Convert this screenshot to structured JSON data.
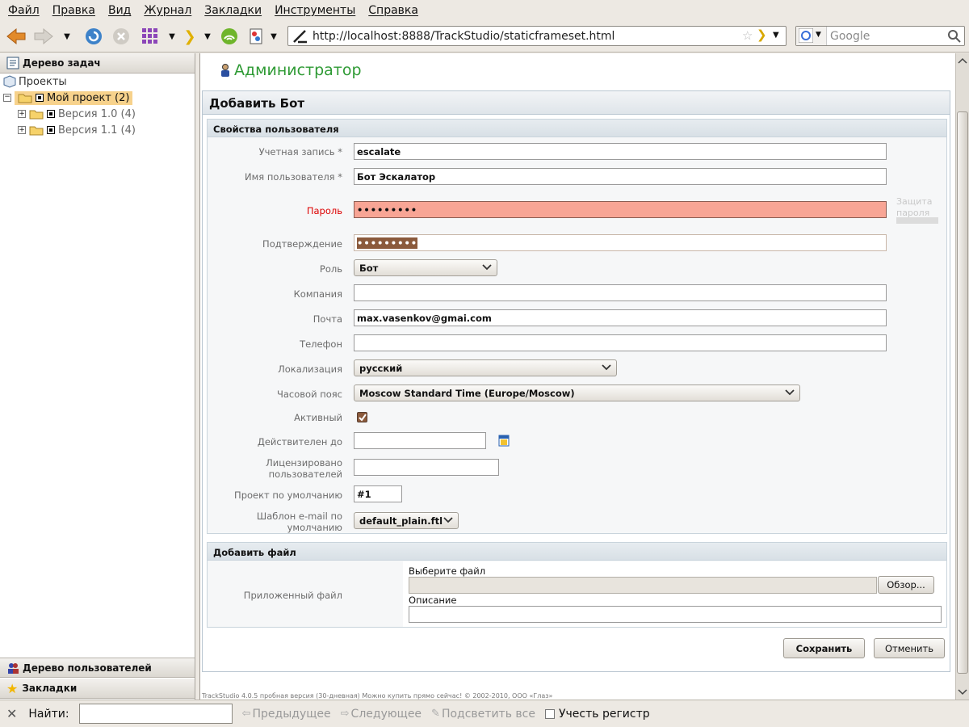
{
  "menu": [
    "Файл",
    "Правка",
    "Вид",
    "Журнал",
    "Закладки",
    "Инструменты",
    "Справка"
  ],
  "url": "http://localhost:8888/TrackStudio/staticframeset.html",
  "search_placeholder": "Google",
  "left": {
    "task_tree": "Дерево задач",
    "projects": "Проекты",
    "my_project": "Мой проект (2)",
    "v10": "Версия 1.0 (4)",
    "v11": "Версия 1.1 (4)",
    "user_tree": "Дерево пользователей",
    "bookmarks": "Закладки"
  },
  "header": {
    "user": "Администратор"
  },
  "form": {
    "title": "Добавить Бот",
    "props_header": "Свойства пользователя",
    "login_label": "Учетная запись *",
    "login": "escalate",
    "name_label": "Имя пользователя *",
    "name": "Бот Эскалатор",
    "password_label": "Пароль",
    "password": "•••••••••",
    "protect_label": "Защита пароля",
    "confirm_label": "Подтверждение",
    "confirm": "•••••••••",
    "role_label": "Роль",
    "role": "Бот",
    "company_label": "Компания",
    "company": "",
    "email_label": "Почта",
    "email": "max.vasenkov@gmai.com",
    "phone_label": "Телефон",
    "phone": "",
    "locale_label": "Локализация",
    "locale": "русский",
    "tz_label": "Часовой пояс",
    "tz": "Moscow Standard Time (Europe/Moscow)",
    "active_label": "Активный",
    "valid_label": "Действителен до",
    "valid": "",
    "licensed_label": "Лицензировано пользователей",
    "licensed": "",
    "default_project_label": "Проект по умолчанию",
    "default_project": "#1",
    "email_tpl_label": "Шаблон e-mail по умолчанию",
    "email_tpl": "default_plain.ftl",
    "file_header": "Добавить файл",
    "attached_label": "Приложенный файл",
    "choose_file": "Выберите файл",
    "browse": "Обзор...",
    "description_label": "Описание",
    "save": "Сохранить",
    "cancel": "Отменить"
  },
  "footer": "TrackStudio 4.0.5 пробная версия (30-дневная) Можно купить прямо сейчас! © 2002-2010, ООО «Глаз»",
  "findbar": {
    "label": "Найти:",
    "prev": "Предыдущее",
    "next": "Следующее",
    "highlight": "Подсветить все",
    "match_case": "Учесть регистр"
  }
}
